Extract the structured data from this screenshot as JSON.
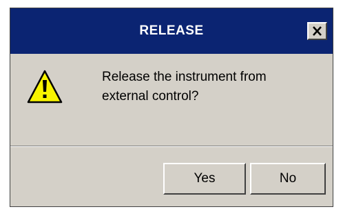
{
  "dialog": {
    "title": "RELEASE",
    "close_icon": "close-x-icon",
    "icon": "warning-triangle-icon",
    "message_line1": "Release the instrument from",
    "message_line2": "external control?",
    "buttons": {
      "yes_label": "Yes",
      "no_label": "No"
    }
  },
  "colors": {
    "titlebar": "#0b2472",
    "dialog_bg": "#d4d0c8",
    "warning_yellow": "#f8f400"
  }
}
